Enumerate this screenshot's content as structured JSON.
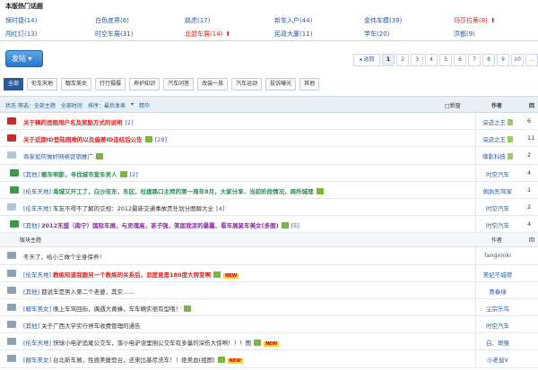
{
  "hot": {
    "title": "本版热门话题",
    "items": [
      {
        "text": "保时捷(14)",
        "color": "blue"
      },
      {
        "text": "白色底界(6)",
        "color": "blue"
      },
      {
        "text": "路虎(17)",
        "color": "blue"
      },
      {
        "text": "新车入户(44)",
        "color": "blue"
      },
      {
        "text": "金伟车模(39)",
        "color": "blue"
      },
      {
        "text": "玛莎拉蒂(8)",
        "color": "red",
        "up": true
      },
      {
        "text": "闯红灯(13)",
        "color": "blue"
      },
      {
        "text": "时空车展(31)",
        "color": "blue"
      },
      {
        "text": "北盟车展(14)",
        "color": "red",
        "up": true
      },
      {
        "text": "民政大厦(11)",
        "color": "blue"
      },
      {
        "text": "学车(20)",
        "color": "blue"
      },
      {
        "text": "洪都(9)",
        "color": "blue"
      }
    ]
  },
  "post_button": "发帖 ▾",
  "pager": {
    "back": "◂ 返回",
    "pages": [
      "1",
      "2",
      "3",
      "4",
      "5",
      "6",
      "7",
      "8",
      "9",
      "10",
      "…"
    ],
    "current": "1"
  },
  "tabs": [
    "全部",
    "伦车天地",
    "靓车美女",
    "行行摄摄",
    "养护知识",
    "汽车问答",
    "改装一族",
    "汽车运动",
    "投诉曝光",
    "其他"
  ],
  "table_header": {
    "filters": [
      "状态 筛选：全部主题",
      "全部时间",
      "排序：最后发表",
      "▾",
      "精华"
    ],
    "new_label": "□新窗",
    "author": "作者",
    "extra": "回"
  },
  "sticky_rows": [
    {
      "icon": "pin",
      "cat": "",
      "title": "关于辆的违限用户名及奖励方式的说明",
      "tcolor": "red",
      "badge": false,
      "count": "[2]",
      "newb": false,
      "author": "深迹之王",
      "shield": true,
      "num": "6"
    },
    {
      "icon": "pin",
      "cat": "",
      "title": "关于近期ID登陆困难的以及偏差ID连结后公告",
      "tcolor": "red",
      "badge": true,
      "count": "[29]",
      "newb": false,
      "author": "深迹之王",
      "shield": true,
      "num": "11"
    },
    {
      "icon": "doc",
      "cat": "",
      "title": "商家如何做好网络营销推广",
      "tcolor": "blue",
      "badge": true,
      "count": "",
      "newb": false,
      "author": "缘影科技",
      "shield": true,
      "num": "2"
    },
    {
      "icon": "up",
      "cat": "[其他]",
      "title": "靓车明影，寻找城市爱车男人",
      "tcolor": "green",
      "badge": true,
      "count": "[2]",
      "newb": false,
      "author": "时空汽车",
      "shield": false,
      "num": "4"
    },
    {
      "icon": "up",
      "cat": "[伦车天地]",
      "title": "南城又开工了，白沙亚东，东区，柱建路口主转的第一周年8月，大家分享，当前阶段情况，商所城理",
      "tcolor": "green",
      "badge": true,
      "count": "",
      "newb": false,
      "author": "佩执形驾家",
      "shield": false,
      "num": "1"
    },
    {
      "icon": "doc",
      "cat": "[伦车天地]",
      "title": "车友不得不了解的交规：2012最新交通事故责任划分图解大全",
      "tcolor": "dark",
      "badge": false,
      "count": "[4]",
      "newb": false,
      "author": "时空汽车",
      "shield": false,
      "num": "2"
    },
    {
      "icon": "up",
      "cat": "[其他]",
      "title": "2012东盟（南宁）国际车展，与灵魂高，甚子强，笑面我凉的暴露，看车展紧车美女(多图)",
      "tcolor": "purple",
      "badge": true,
      "count": "[5]",
      "newb": false,
      "author": "时空汽车",
      "shield": false,
      "num": "4"
    }
  ],
  "section": {
    "label": "版块主题",
    "author": "作者",
    "extra": "回"
  },
  "normal_rows": [
    {
      "icon": "sm",
      "cat": "",
      "title": "冬天了，给小三做个全身保养！",
      "tcolor": "dark",
      "badge": false,
      "count": "",
      "newb": false,
      "author": "fangxinki",
      "shield": false,
      "num": ""
    },
    {
      "icon": "sm",
      "cat": "[伦车天地]",
      "title": "教练知道我跟另一个教练的关系后，恋度竟是180度大转变啊",
      "tcolor": "red",
      "badge": true,
      "count": "",
      "newb": true,
      "author": "美妃不城荷",
      "shield": false,
      "num": ""
    },
    {
      "icon": "sm",
      "cat": "[其他]",
      "title": "都说车是男人第二个老婆，其实......",
      "tcolor": "dark",
      "badge": false,
      "count": "",
      "newb": false,
      "author": "青春绿",
      "shield": false,
      "num": ""
    },
    {
      "icon": "sm",
      "cat": "[靓车美女]",
      "title": "晚上车驾回街，偶遇大黄蜂，车车确实很有型哦！",
      "tcolor": "dark",
      "badge": true,
      "count": "",
      "newb": false,
      "author": "尘宗乐鸟",
      "shield": false,
      "num": ""
    },
    {
      "icon": "sm",
      "cat": "[其他]",
      "title": "关于广西大学实行停车收费管理的通告",
      "tcolor": "dark",
      "badge": false,
      "count": "",
      "newb": false,
      "author": "时空汽车",
      "shield": false,
      "num": ""
    },
    {
      "icon": "sm",
      "cat": "[伦车天地]",
      "title": "快球小电驴追尾公交车，落小电驴误里围公交车有多量的深伤大惊啊！！！图",
      "tcolor": "dark",
      "badge": true,
      "count": "",
      "newb": true,
      "author": "白、斑猴",
      "shield": false,
      "num": ""
    },
    {
      "icon": "sm",
      "cat": "[靓车美女]",
      "title": "台北新车展，性感美媛登台，还来比基尼洗车！！绝美血(组图)",
      "tcolor": "dark",
      "badge": true,
      "count": "",
      "newb": true,
      "author": "小老鼠V",
      "shield": false,
      "num": ""
    }
  ]
}
